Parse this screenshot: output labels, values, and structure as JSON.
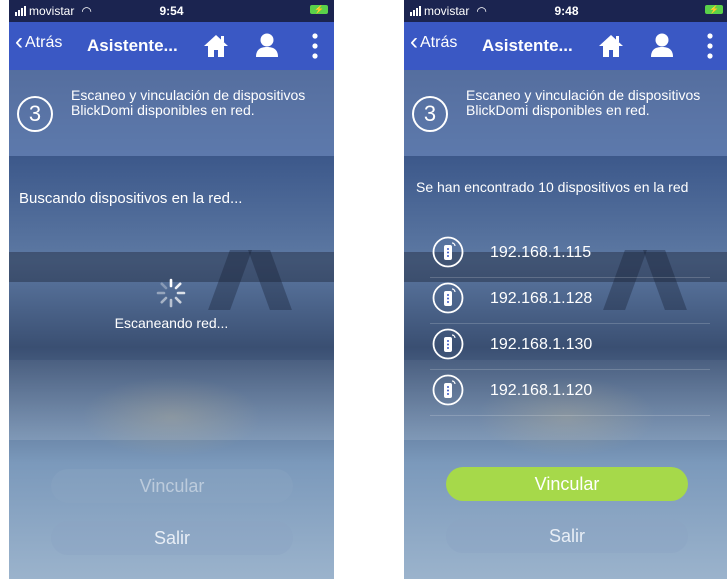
{
  "left": {
    "status_bar": {
      "carrier": "movistar",
      "time": "9:54"
    },
    "nav": {
      "back_label": "Atrás",
      "title": "Asistente..."
    },
    "step": {
      "number": "3",
      "text": "Escaneo y vinculación de dispositivos BlickDomi disponibles en red."
    },
    "status_text": "Buscando dispositivos en la red...",
    "spinner_label": "Escaneando red...",
    "buttons": {
      "link_label": "Vincular",
      "exit_label": "Salir"
    }
  },
  "right": {
    "status_bar": {
      "carrier": "movistar",
      "time": "9:48"
    },
    "nav": {
      "back_label": "Atrás",
      "title": "Asistente..."
    },
    "step": {
      "number": "3",
      "text": "Escaneo y vinculación de dispositivos BlickDomi disponibles en red."
    },
    "found_text": "Se han encontrado 10 dispositivos en la red",
    "devices": [
      {
        "ip": "192.168.1.115"
      },
      {
        "ip": "192.168.1.128"
      },
      {
        "ip": "192.168.1.130"
      },
      {
        "ip": "192.168.1.120"
      }
    ],
    "buttons": {
      "link_label": "Vincular",
      "exit_label": "Salir"
    }
  },
  "icons": [
    "signal-icon",
    "wifi-icon",
    "battery-icon",
    "back-chevron-icon",
    "home-icon",
    "user-icon",
    "more-vertical-icon",
    "spinner-icon",
    "device-icon"
  ],
  "colors": {
    "nav": "#3a58c4",
    "status_bar": "#1b2450",
    "primary_button": "#a6d94a",
    "battery": "#5ad14a"
  }
}
